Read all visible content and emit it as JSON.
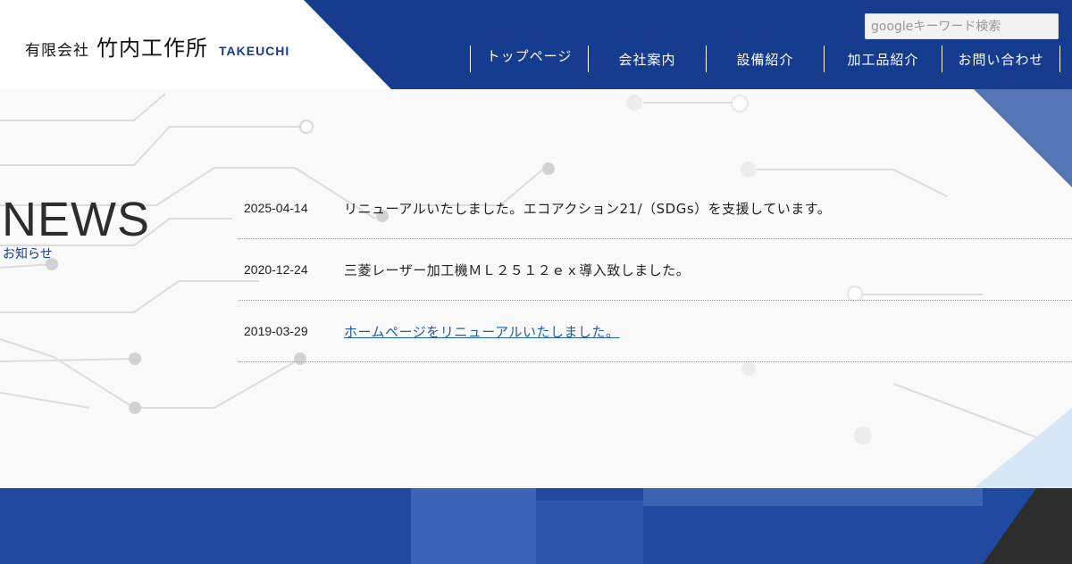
{
  "header": {
    "logo_prefix": "有限会社",
    "logo_name": "竹内工作所",
    "logo_latin": "TAKEUCHI",
    "search_placeholder": "googleキーワード検索",
    "nav": [
      {
        "label": "トップページ"
      },
      {
        "label": "会社案内"
      },
      {
        "label": "設備紹介"
      },
      {
        "label": "加工品紹介"
      },
      {
        "label": "お問い合わせ"
      }
    ]
  },
  "news": {
    "title": "NEWS",
    "subtitle": "お知らせ",
    "items": [
      {
        "date": "2025-04-14",
        "text": "リニューアルいたしました。エコアクション21/（SDGs）を支援しています。"
      },
      {
        "date": "2020-12-24",
        "text": "三菱レーザー加工機ＭＬ２５１２ｅｘ導入致しました。"
      },
      {
        "date": "2019-03-29",
        "text": "ホームページをリニューアルいたしました。"
      }
    ]
  },
  "colors": {
    "brand_blue": "#153c8e",
    "link_blue": "#1f5fa8",
    "band_blue": "#1f4aa0",
    "light_blue": "#d6e8f7"
  }
}
